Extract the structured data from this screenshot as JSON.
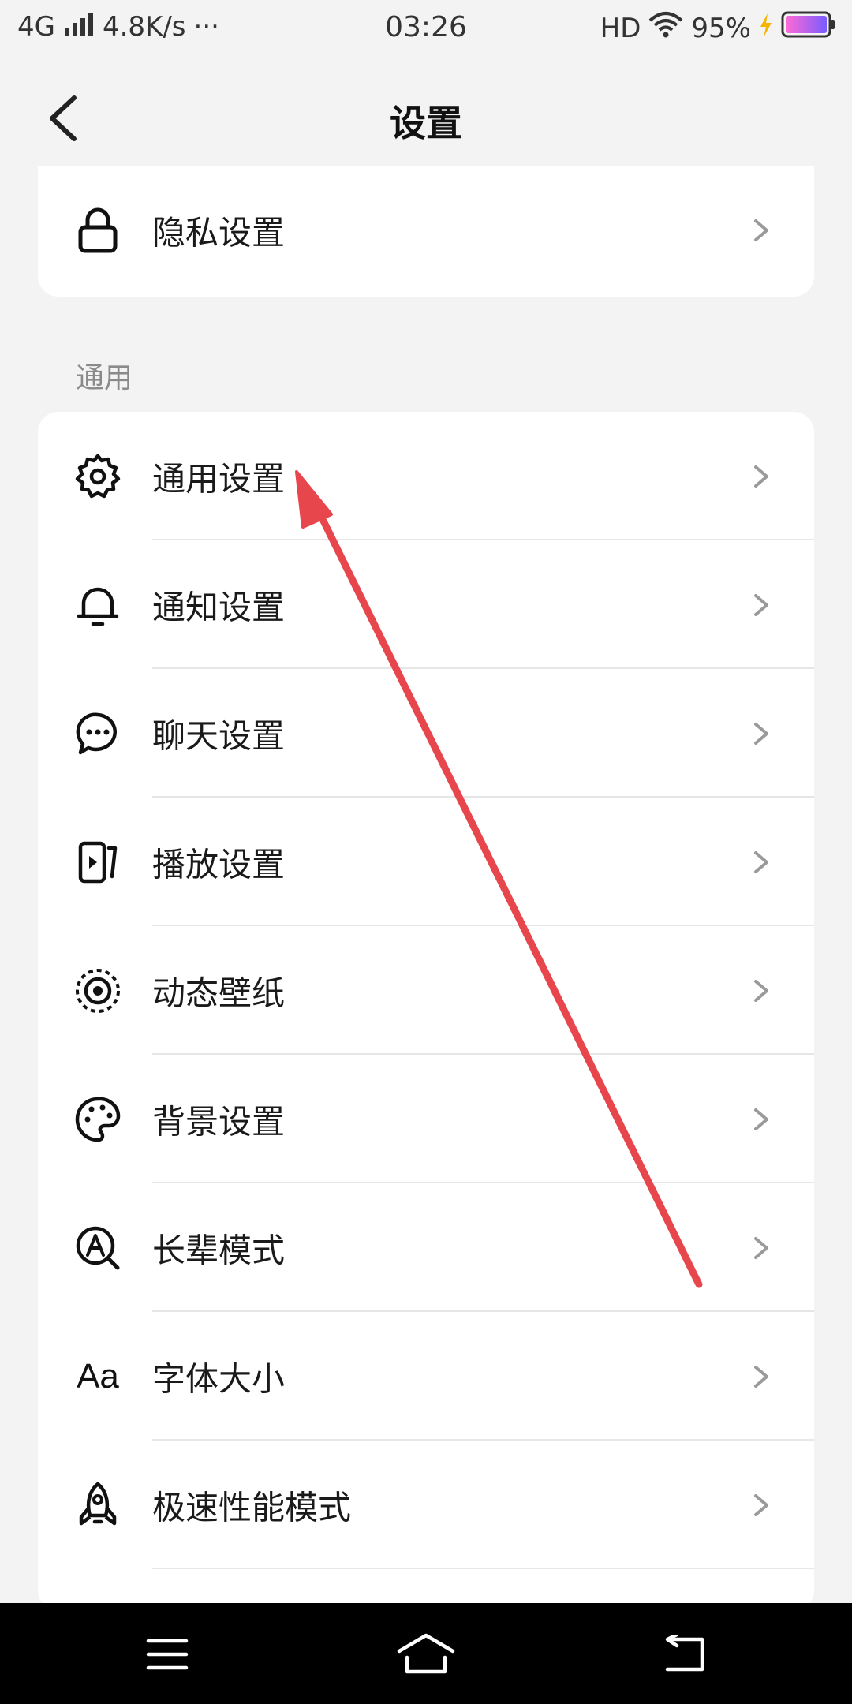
{
  "status_bar": {
    "network": "4G",
    "speed": "4.8K/s",
    "more": "···",
    "time": "03:26",
    "hd": "HD",
    "battery": "95%"
  },
  "header": {
    "title": "设置"
  },
  "top_card": {
    "items": [
      {
        "label": "隐私设置",
        "icon": "lock-icon"
      }
    ]
  },
  "section": {
    "label": "通用"
  },
  "main_card": {
    "items": [
      {
        "label": "通用设置",
        "icon": "gear-icon"
      },
      {
        "label": "通知设置",
        "icon": "bell-icon"
      },
      {
        "label": "聊天设置",
        "icon": "chat-bubble-icon"
      },
      {
        "label": "播放设置",
        "icon": "play-icon"
      },
      {
        "label": "动态壁纸",
        "icon": "dynamic-wallpaper-icon"
      },
      {
        "label": "背景设置",
        "icon": "palette-icon"
      },
      {
        "label": "长辈模式",
        "icon": "elder-mode-icon"
      },
      {
        "label": "字体大小",
        "icon": "font-size-icon",
        "icon_text": "Aa"
      },
      {
        "label": "极速性能模式",
        "icon": "rocket-icon"
      }
    ]
  },
  "colors": {
    "annotation_arrow": "#e8464d",
    "background": "#f3f3f3",
    "card": "#ffffff",
    "nav_bar": "#000000"
  }
}
